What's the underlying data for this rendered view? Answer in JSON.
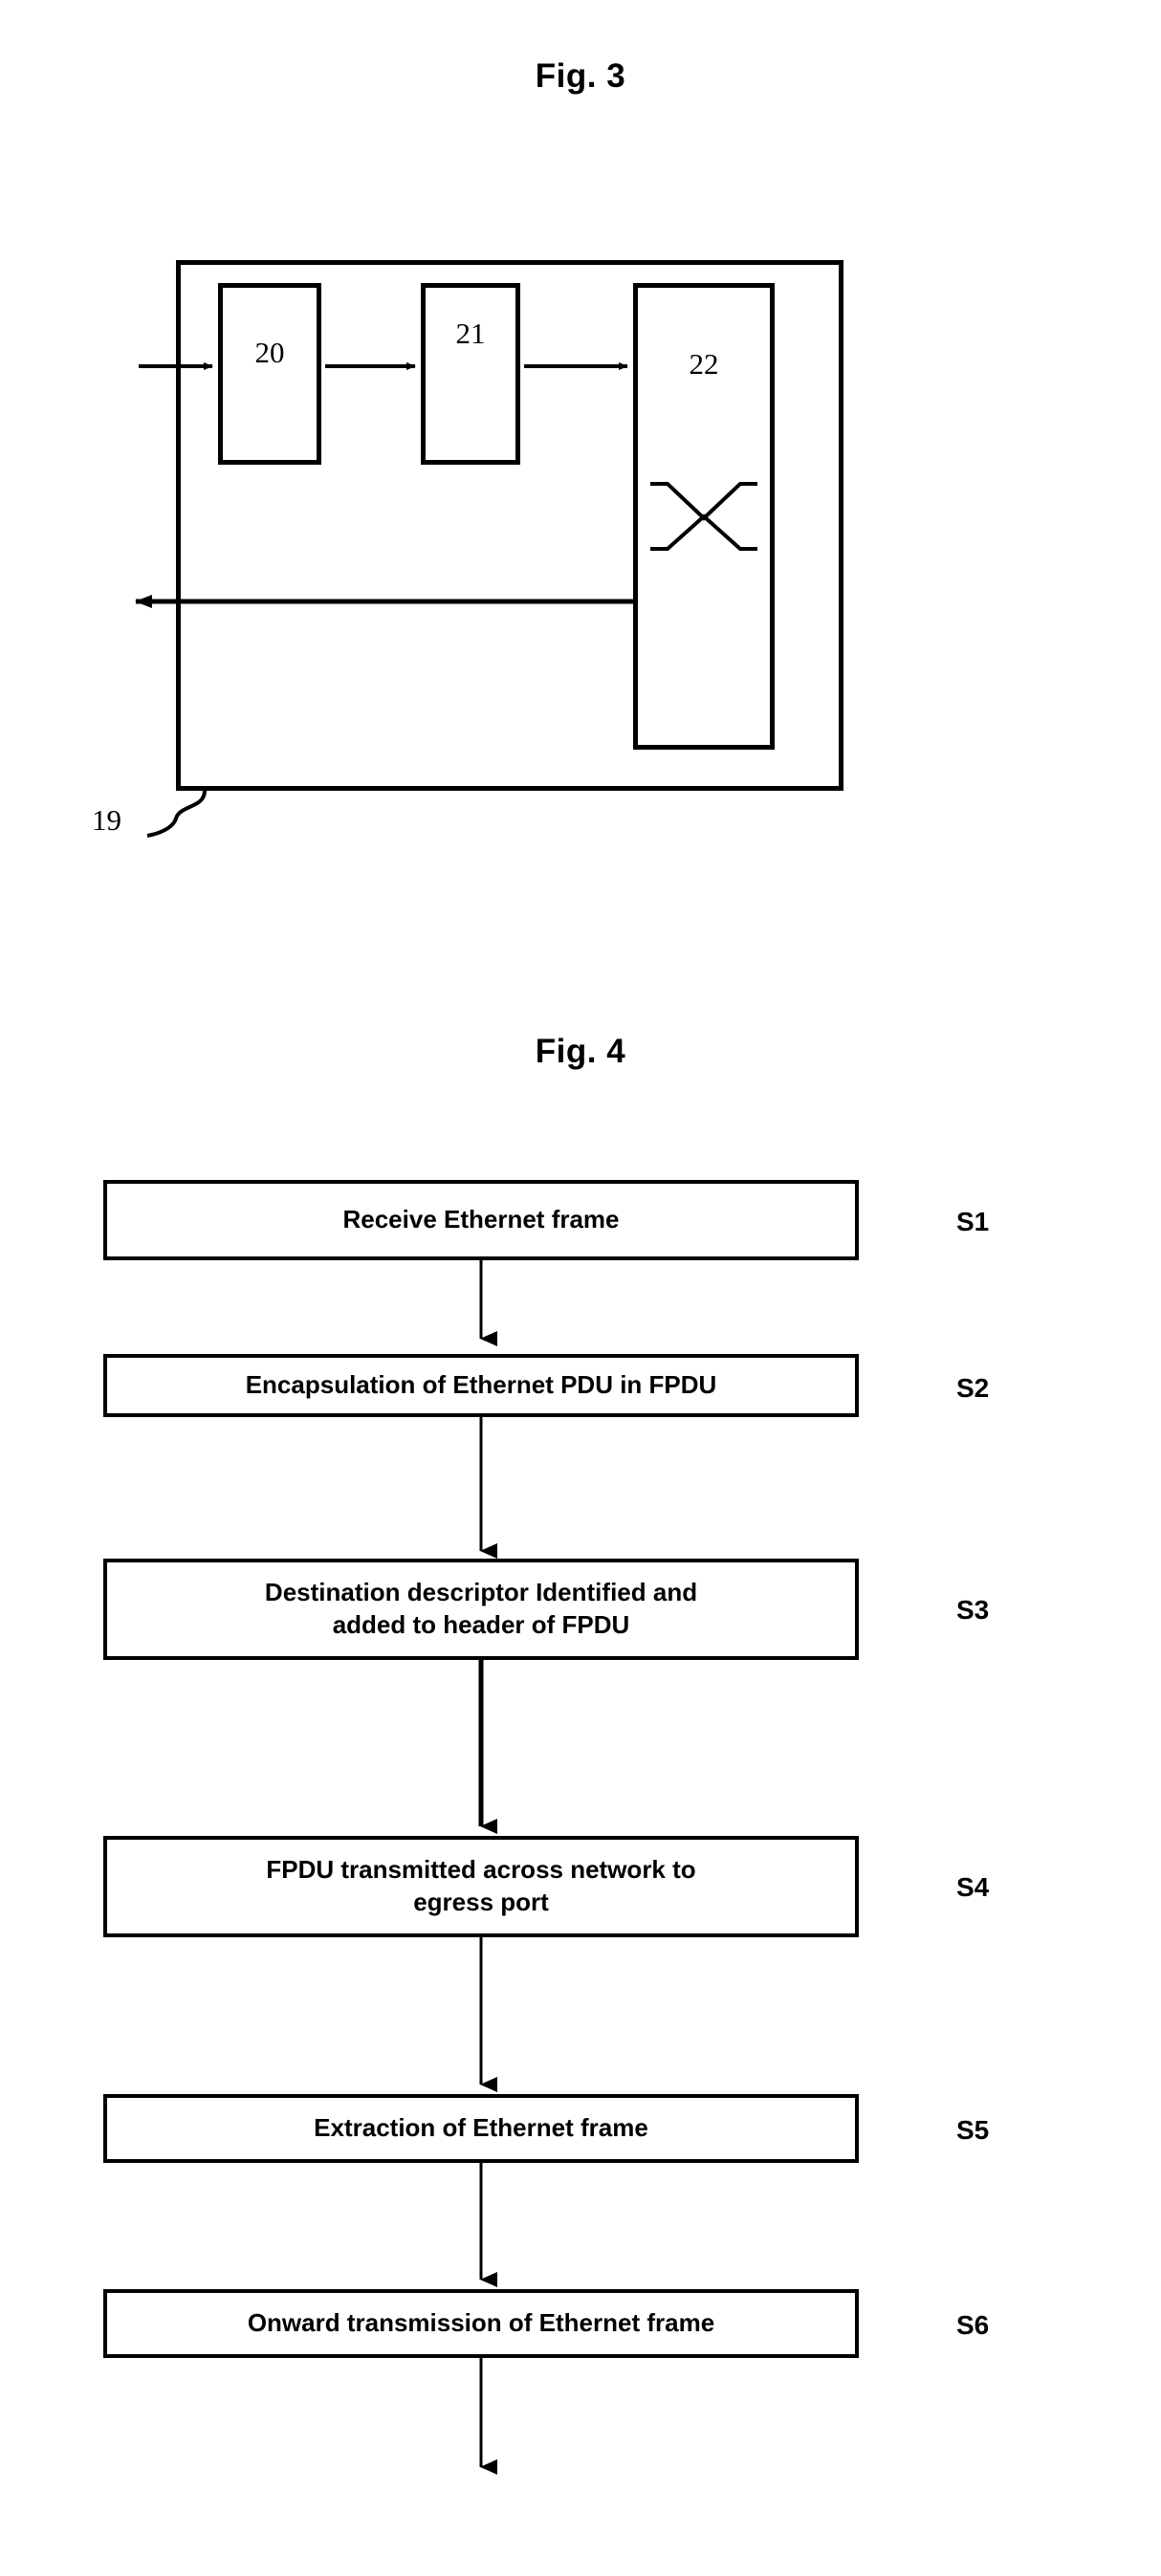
{
  "figures": [
    {
      "id": "fig3",
      "title": "Fig. 3",
      "reference_numeral": "19",
      "blocks": [
        {
          "label": "20"
        },
        {
          "label": "21"
        },
        {
          "label": "22"
        }
      ],
      "symbols": [
        {
          "name": "crossbar-x",
          "in_block": "22"
        }
      ],
      "connections": [
        {
          "from": "input",
          "to": "20",
          "direction": "right"
        },
        {
          "from": "20",
          "to": "21",
          "direction": "right"
        },
        {
          "from": "21",
          "to": "22",
          "direction": "right"
        },
        {
          "from": "22",
          "to": "output",
          "direction": "left"
        }
      ]
    },
    {
      "id": "fig4",
      "title": "Fig. 4",
      "steps": [
        {
          "step": "S1",
          "text": "Receive Ethernet frame"
        },
        {
          "step": "S2",
          "text": "Encapsulation of Ethernet PDU in FPDU"
        },
        {
          "step": "S3",
          "text": "Destination descriptor Identified and\nadded to header of FPDU"
        },
        {
          "step": "S4",
          "text": "FPDU transmitted across network to\negress port"
        },
        {
          "step": "S5",
          "text": "Extraction of Ethernet frame"
        },
        {
          "step": "S6",
          "text": "Onward transmission of Ethernet frame"
        }
      ]
    }
  ],
  "colors": {
    "ink": "#000000",
    "paper": "#ffffff"
  }
}
